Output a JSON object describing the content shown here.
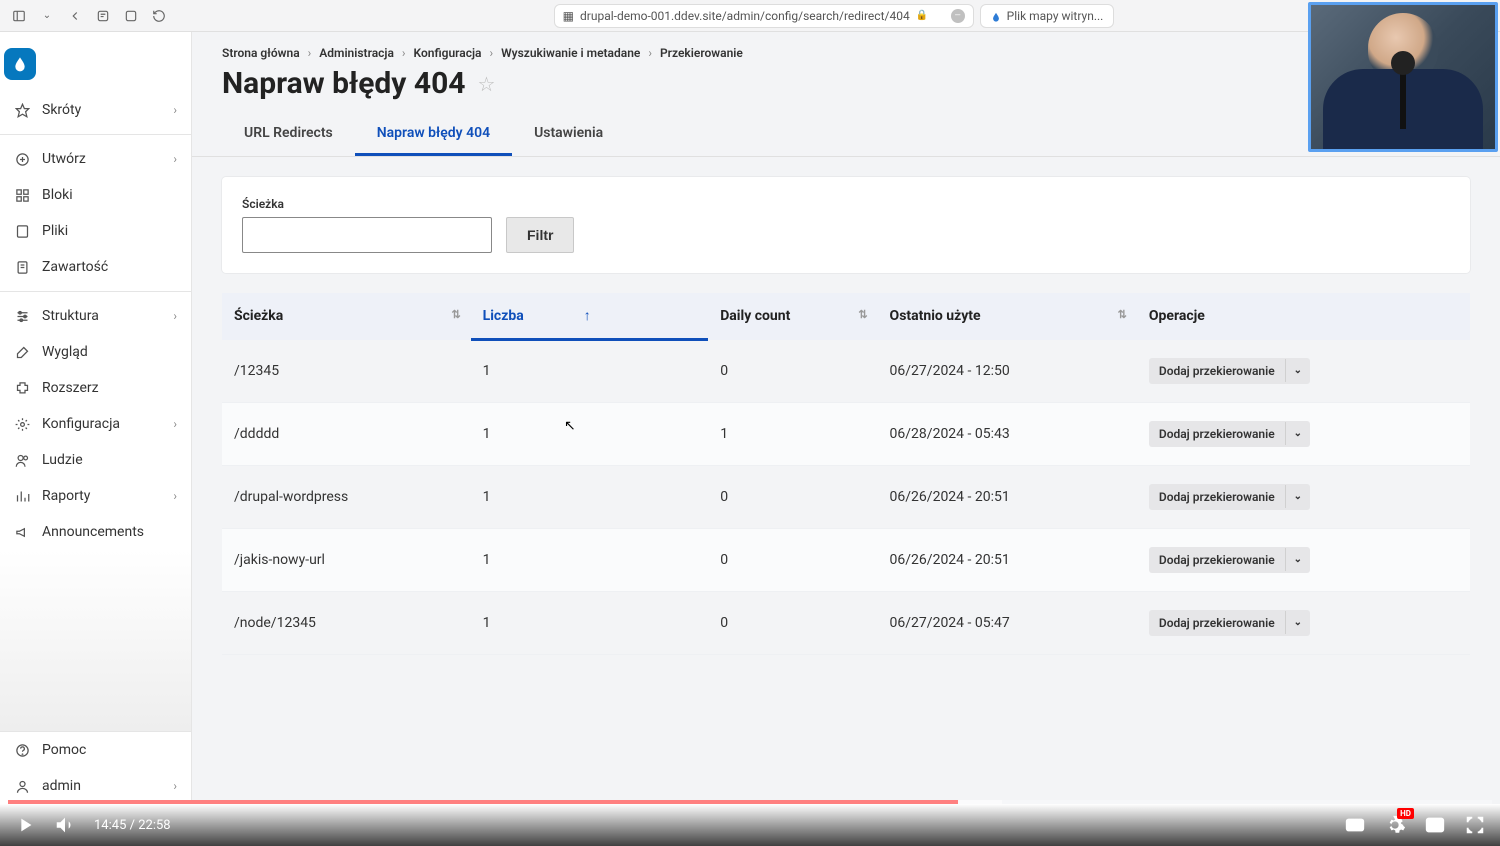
{
  "browser": {
    "url": "drupal-demo-001.ddev.site/admin/config/search/redirect/404",
    "bookmark_label": "Plik mapy witryn..."
  },
  "sidebar": {
    "items": [
      {
        "label": "Skróty",
        "icon": "star",
        "chevron": true
      },
      {
        "label": "Utwórz",
        "icon": "plus",
        "chevron": true,
        "sep_before": true
      },
      {
        "label": "Bloki",
        "icon": "grid",
        "chevron": false
      },
      {
        "label": "Pliki",
        "icon": "file",
        "chevron": false
      },
      {
        "label": "Zawartość",
        "icon": "doc",
        "chevron": false
      },
      {
        "label": "Struktura",
        "icon": "sliders",
        "chevron": true,
        "sep_before": true
      },
      {
        "label": "Wygląd",
        "icon": "brush",
        "chevron": false
      },
      {
        "label": "Rozszerz",
        "icon": "puzzle",
        "chevron": false
      },
      {
        "label": "Konfiguracja",
        "icon": "gears",
        "chevron": true
      },
      {
        "label": "Ludzie",
        "icon": "people",
        "chevron": false
      },
      {
        "label": "Raporty",
        "icon": "chart",
        "chevron": true
      },
      {
        "label": "Announcements",
        "icon": "megaphone",
        "chevron": false
      }
    ],
    "bottom": [
      {
        "label": "Pomoc",
        "icon": "help",
        "chevron": false
      },
      {
        "label": "admin",
        "icon": "user",
        "chevron": true
      }
    ]
  },
  "breadcrumb": [
    "Strona główna",
    "Administracja",
    "Konfiguracja",
    "Wyszukiwanie i metadane",
    "Przekierowanie"
  ],
  "page_title": "Napraw błędy 404",
  "tabs": [
    {
      "label": "URL Redirects",
      "active": false
    },
    {
      "label": "Napraw błędy 404",
      "active": true
    },
    {
      "label": "Ustawienia",
      "active": false
    }
  ],
  "filter": {
    "path_label": "Ścieżka",
    "path_value": "",
    "button": "Filtr"
  },
  "table": {
    "columns": [
      {
        "label": "Ścieżka",
        "sortable": true,
        "sorted": false
      },
      {
        "label": "Liczba",
        "sortable": true,
        "sorted": true,
        "dir": "asc"
      },
      {
        "label": "Daily count",
        "sortable": true,
        "sorted": false
      },
      {
        "label": "Ostatnio użyte",
        "sortable": true,
        "sorted": false
      },
      {
        "label": "Operacje",
        "sortable": false,
        "sorted": false
      }
    ],
    "op_label": "Dodaj przekierowanie",
    "rows": [
      {
        "path": "/12345",
        "count": "1",
        "daily": "0",
        "last": "06/27/2024 - 12:50"
      },
      {
        "path": "/ddddd",
        "count": "1",
        "daily": "1",
        "last": "06/28/2024 - 05:43"
      },
      {
        "path": "/drupal-wordpress",
        "count": "1",
        "daily": "0",
        "last": "06/26/2024 - 20:51"
      },
      {
        "path": "/jakis-nowy-url",
        "count": "1",
        "daily": "0",
        "last": "06/26/2024 - 20:51"
      },
      {
        "path": "/node/12345",
        "count": "1",
        "daily": "0",
        "last": "06/27/2024 - 05:47"
      }
    ]
  },
  "player": {
    "current": "14:45",
    "total": "22:58"
  }
}
